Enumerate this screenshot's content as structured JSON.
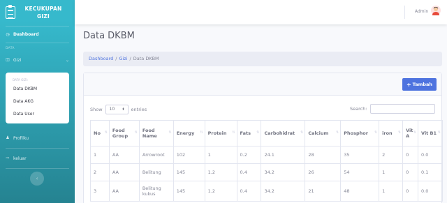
{
  "sidebar": {
    "brand": "KECUKUPAN GIZI",
    "dashboard": "Dashboard",
    "heading_data": "DATA",
    "gizi": "Gizi",
    "collapse_heading": "DATA GIZI:",
    "collapse_items": [
      "Data DKBM",
      "Data AKG",
      "Data User"
    ],
    "profil": "Profilku",
    "keluar": "keluar"
  },
  "topbar": {
    "user": "Admin"
  },
  "page": {
    "title": "Data DKBM",
    "breadcrumb": [
      "Dashboard",
      "Gizi",
      "Data DKBM"
    ]
  },
  "card": {
    "add_button": "Tambah",
    "show_label": "Show",
    "entries_value": "10",
    "entries_label": "entries",
    "search_label": "Search:"
  },
  "table": {
    "headers": [
      "No",
      "Food Group",
      "Food Name",
      "Energy",
      "Protein",
      "Fats",
      "Carbohidrat",
      "Calcium",
      "Phosphor",
      "iron",
      "Vit A",
      "Vit B1"
    ],
    "rows": [
      [
        "1",
        "AA",
        "Arrowroot",
        "102",
        "1",
        "0.2",
        "24.1",
        "28",
        "35",
        "2",
        "0",
        "0.0"
      ],
      [
        "2",
        "AA",
        "Belitung",
        "145",
        "1.2",
        "0.4",
        "34.2",
        "26",
        "54",
        "1",
        "0",
        "0.1"
      ],
      [
        "3",
        "AA",
        "Belitung kukus",
        "145",
        "1.2",
        "0.4",
        "34.2",
        "21",
        "48",
        "1",
        "0",
        "0.0"
      ]
    ]
  }
}
